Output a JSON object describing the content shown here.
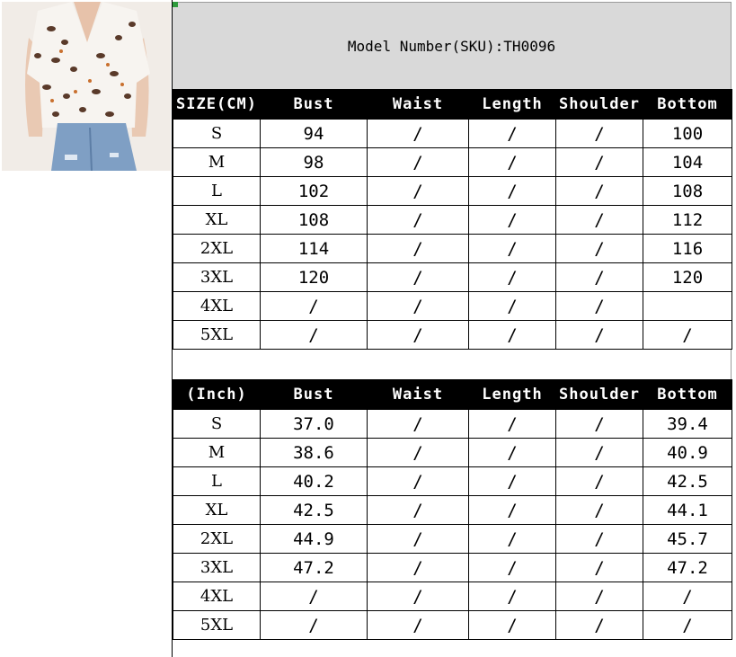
{
  "model_label": "Model Number(SKU):TH0096",
  "table_cm": {
    "headers": [
      "SIZE(CM)",
      "Bust",
      "Waist",
      "Length",
      "Shoulder",
      "Bottom"
    ],
    "rows": [
      [
        "S",
        "94",
        "/",
        "/",
        "/",
        "100"
      ],
      [
        "M",
        "98",
        "/",
        "/",
        "/",
        "104"
      ],
      [
        "L",
        "102",
        "/",
        "/",
        "/",
        "108"
      ],
      [
        "XL",
        "108",
        "/",
        "/",
        "/",
        "112"
      ],
      [
        "2XL",
        "114",
        "/",
        "/",
        "/",
        "116"
      ],
      [
        "3XL",
        "120",
        "/",
        "/",
        "/",
        "120"
      ],
      [
        "4XL",
        "/",
        "/",
        "/",
        "/",
        ""
      ],
      [
        "5XL",
        "/",
        "/",
        "/",
        "/",
        "/"
      ]
    ]
  },
  "table_inch": {
    "headers": [
      "(Inch)",
      "Bust",
      "Waist",
      "Length",
      "Shoulder",
      "Bottom"
    ],
    "rows": [
      [
        "S",
        "37.0",
        "/",
        "/",
        "/",
        "39.4"
      ],
      [
        "M",
        "38.6",
        "/",
        "/",
        "/",
        "40.9"
      ],
      [
        "L",
        "40.2",
        "/",
        "/",
        "/",
        "42.5"
      ],
      [
        "XL",
        "42.5",
        "/",
        "/",
        "/",
        "44.1"
      ],
      [
        "2XL",
        "44.9",
        "/",
        "/",
        "/",
        "45.7"
      ],
      [
        "3XL",
        "47.2",
        "/",
        "/",
        "/",
        "47.2"
      ],
      [
        "4XL",
        "/",
        "/",
        "/",
        "/",
        "/"
      ],
      [
        "5XL",
        "/",
        "/",
        "/",
        "/",
        "/"
      ]
    ]
  }
}
